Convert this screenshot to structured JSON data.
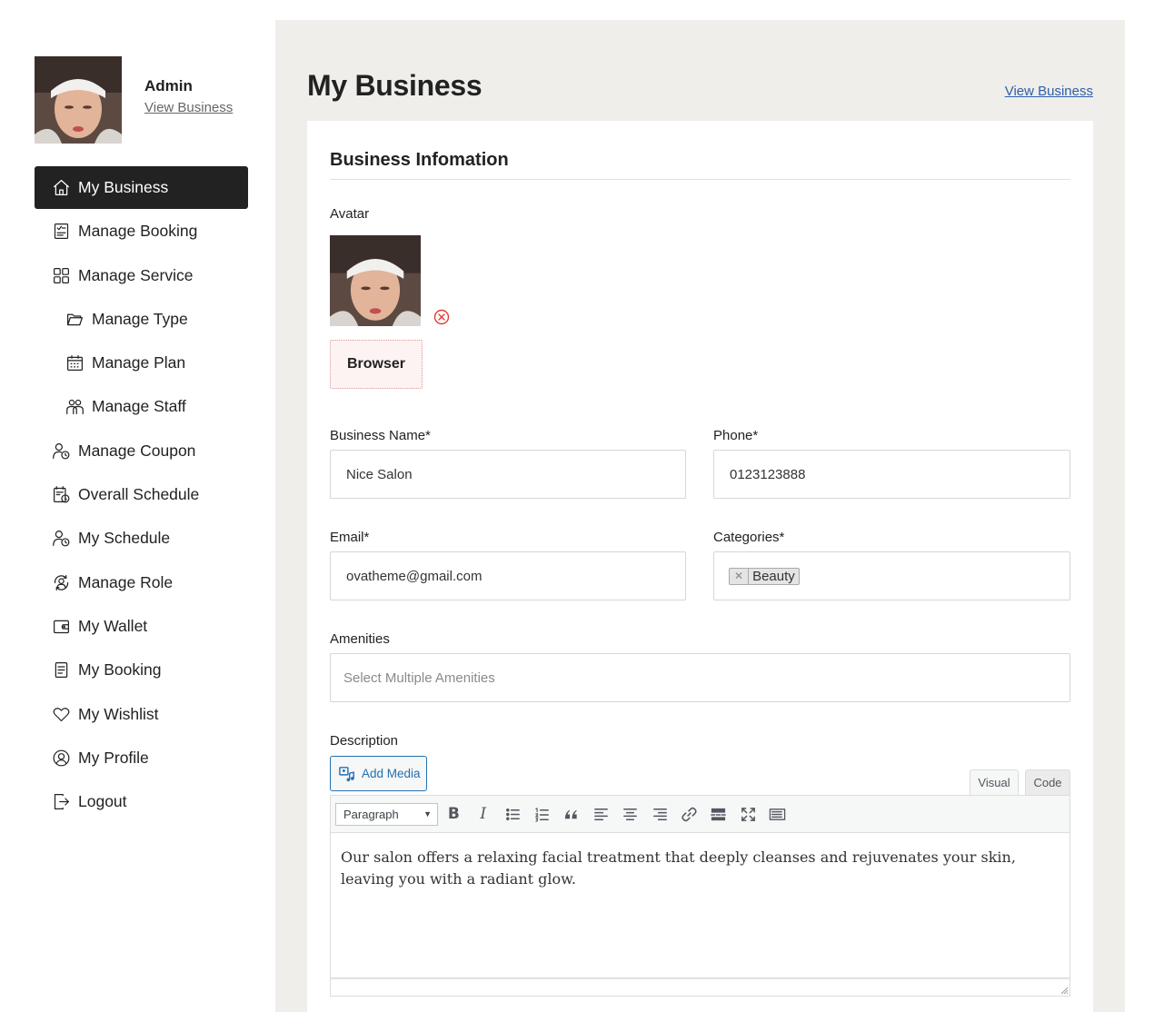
{
  "sidebar": {
    "profile": {
      "name": "Admin",
      "link": "View Business"
    },
    "items": [
      {
        "label": "My Business",
        "icon": "home-icon",
        "active": true
      },
      {
        "label": "Manage Booking",
        "icon": "booking-list-icon"
      },
      {
        "label": "Manage Service",
        "icon": "grid-icon"
      },
      {
        "label": "Manage Type",
        "icon": "folder-icon",
        "sub": true
      },
      {
        "label": "Manage Plan",
        "icon": "calendar-icon",
        "sub": true
      },
      {
        "label": "Manage Staff",
        "icon": "staff-icon",
        "sub": true
      },
      {
        "label": "Manage Coupon",
        "icon": "user-clock-icon"
      },
      {
        "label": "Overall Schedule",
        "icon": "schedule-icon"
      },
      {
        "label": "My Schedule",
        "icon": "user-clock-icon"
      },
      {
        "label": "Manage Role",
        "icon": "user-cycle-icon"
      },
      {
        "label": "My Wallet",
        "icon": "wallet-icon"
      },
      {
        "label": "My Booking",
        "icon": "document-icon"
      },
      {
        "label": "My Wishlist",
        "icon": "heart-icon"
      },
      {
        "label": "My Profile",
        "icon": "user-circle-icon"
      },
      {
        "label": "Logout",
        "icon": "logout-icon"
      }
    ]
  },
  "main": {
    "title": "My Business",
    "view_business_link": "View Business",
    "section_title": "Business Infomation",
    "avatar_label": "Avatar",
    "browse_label": "Browser",
    "business_name": {
      "label": "Business Name*",
      "value": "Nice Salon"
    },
    "phone": {
      "label": "Phone*",
      "value": "0123123888"
    },
    "email": {
      "label": "Email*",
      "value": "ovatheme@gmail.com"
    },
    "categories": {
      "label": "Categories*",
      "tags": [
        "Beauty"
      ]
    },
    "amenities": {
      "label": "Amenities",
      "placeholder": "Select Multiple Amenities"
    },
    "description": {
      "label": "Description",
      "add_media": "Add Media",
      "tabs": [
        "Visual",
        "Code"
      ],
      "format": "Paragraph",
      "text": "Our salon offers a relaxing facial treatment that deeply cleanses and rejuvenates your skin, leaving you with a radiant glow."
    }
  },
  "colors": {
    "active_nav_bg": "#222222",
    "main_bg": "#efeeeb",
    "link": "#2e5fa8",
    "wp_blue": "#2271b1",
    "remove_red": "#e03c31"
  }
}
